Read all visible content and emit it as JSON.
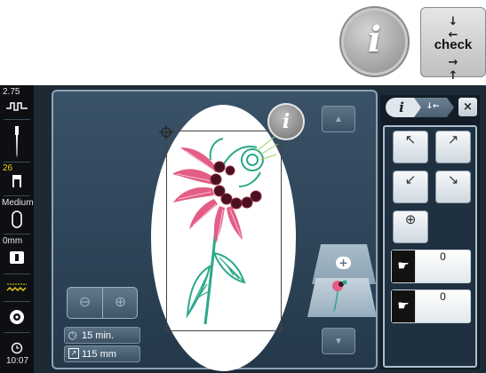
{
  "toolbar": {
    "info_label": "i",
    "check_top_arrows": "↓ ←",
    "check_label": "check",
    "check_bottom_arrows": "→ ↑"
  },
  "sidebar": {
    "tension_value": "2.75",
    "needle_number": "26",
    "foot_size": "Medium",
    "stitch_width": "0mm",
    "time": "10:07"
  },
  "main": {
    "info_label": "i",
    "time_estimate": "15 min.",
    "size_estimate": "115 mm"
  },
  "panel": {
    "tab_info": "i",
    "tab_check": "check",
    "close": "×",
    "move_up_left": "↖",
    "move_up_right": "↗",
    "move_down_left": "↙",
    "move_down_right": "↘",
    "center": "⊕",
    "counter_1_value": "0",
    "counter_2_value": "0"
  },
  "colors": {
    "screen_bg": "#1c2a36",
    "flower_pink": "#e35d86",
    "flower_teal": "#2aa98a",
    "flower_maroon": "#4a1020"
  }
}
